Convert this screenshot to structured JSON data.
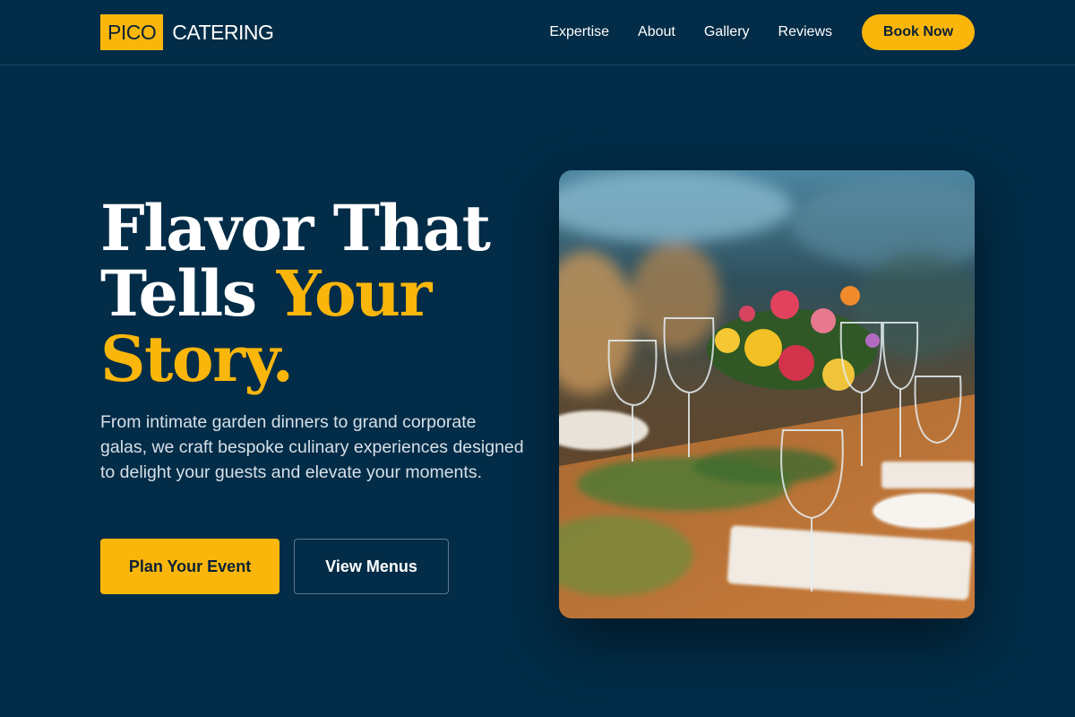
{
  "brand": {
    "logo_box": "PICO",
    "logo_text": "CATERING"
  },
  "nav": {
    "links": [
      "Expertise",
      "About",
      "Gallery",
      "Reviews"
    ],
    "cta": "Book Now"
  },
  "hero": {
    "title_line1": "Flavor That",
    "title_line2_a": "Tells ",
    "title_line2_b": "Your",
    "title_line3": "Story.",
    "subtitle": "From intimate garden dinners to grand corporate galas, we craft bespoke culinary experiences designed to delight your guests and elevate your moments.",
    "primary_button": "Plan Your Event",
    "secondary_button": "View Menus"
  },
  "colors": {
    "background": "#022c47",
    "accent": "#fbb60b",
    "text": "#ffffff"
  }
}
